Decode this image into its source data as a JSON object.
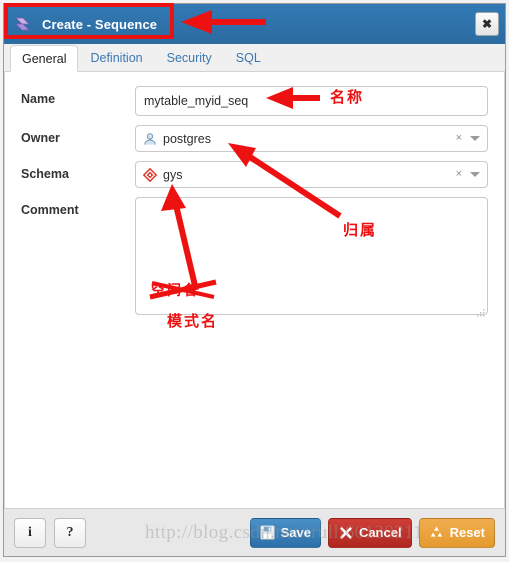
{
  "window": {
    "title": "Create - Sequence",
    "title_icon": "sequence-icon",
    "close_label": "✖"
  },
  "tabs": [
    {
      "label": "General",
      "active": true
    },
    {
      "label": "Definition",
      "active": false
    },
    {
      "label": "Security",
      "active": false
    },
    {
      "label": "SQL",
      "active": false
    }
  ],
  "form": {
    "name": {
      "label": "Name",
      "value": "mytable_myid_seq",
      "placeholder": ""
    },
    "owner": {
      "label": "Owner",
      "value": "postgres",
      "icon": "user-icon",
      "clear": "×",
      "caret": "chevron-down-icon"
    },
    "schema": {
      "label": "Schema",
      "value": "gys",
      "icon": "schema-diamond-icon",
      "clear": "×",
      "caret": "chevron-down-icon"
    },
    "comment": {
      "label": "Comment",
      "value": "",
      "placeholder": ""
    }
  },
  "footer": {
    "info_label": "i",
    "help_label": "?",
    "save_label": "Save",
    "cancel_label": "Cancel",
    "reset_label": "Reset",
    "save_icon": "floppy-disk-icon",
    "cancel_icon": "x-mark-icon",
    "reset_icon": "recycle-icon"
  },
  "watermark": {
    "text": "http://blog.csdn.net/trulli60139211"
  },
  "annotations": [
    {
      "id": "anno-title",
      "text": "",
      "note": "red box + left arrow on title bar"
    },
    {
      "id": "anno-name",
      "text": "名称",
      "note": "arrow pointing to Name value"
    },
    {
      "id": "anno-owner",
      "text": "归属",
      "note": "arrow pointing to Owner value"
    },
    {
      "id": "anno-schema",
      "text": "模式名",
      "note": "arrow pointing to Schema value"
    },
    {
      "id": "anno-struck",
      "text": "空间名",
      "note": "crossed-out label above 模式名"
    }
  ],
  "colors": {
    "titlebar": "#2f72ac",
    "annotation_red": "#ee1111",
    "save": "#2c6fa8",
    "cancel": "#b02720",
    "reset": "#e59a2f",
    "tab_link": "#3b78b4"
  }
}
